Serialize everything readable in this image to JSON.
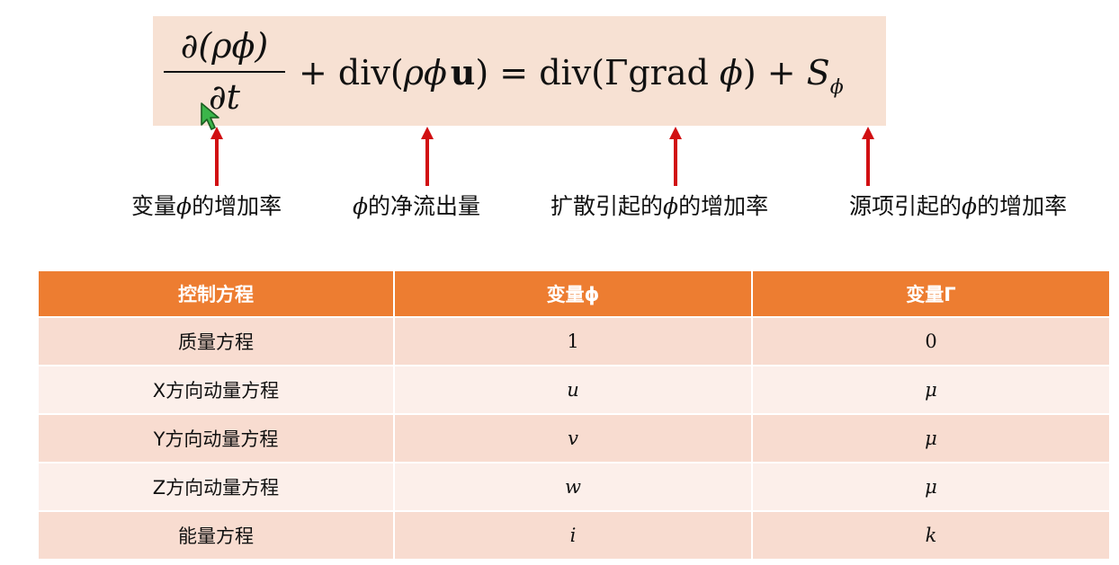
{
  "equation": {
    "numerator": "∂(ρϕ)",
    "denominator": "∂t",
    "plus1": "+ div(",
    "rho_phi": "ρϕ",
    "u": "u",
    "eq_mid": ") = div(Γgrad ",
    "phi2": "ϕ",
    "close_plus": ") + ",
    "S": "S",
    "S_sub": "ϕ"
  },
  "annotations": [
    {
      "pre": "变量",
      "phi": "ϕ",
      "post": "的增加率"
    },
    {
      "pre": "",
      "phi": "ϕ",
      "post": "的净流出量"
    },
    {
      "pre": "扩散引起的",
      "phi": "ϕ",
      "post": "的增加率"
    },
    {
      "pre": "源项引起的",
      "phi": "ϕ",
      "post": "的增加率"
    }
  ],
  "table": {
    "headers": [
      "控制方程",
      "变量ϕ",
      "变量Γ"
    ],
    "rows": [
      [
        "质量方程",
        "1",
        "0"
      ],
      [
        "X方向动量方程",
        "u",
        "μ"
      ],
      [
        "Y方向动量方程",
        "v",
        "μ"
      ],
      [
        "Z方向动量方程",
        "w",
        "μ"
      ],
      [
        "能量方程",
        "i",
        "k"
      ]
    ]
  },
  "colors": {
    "equation_bg": "#f7e1d3",
    "arrow": "#d10f12",
    "header_bg": "#ed7d31",
    "row_odd": "#f8dcd0",
    "row_even": "#fcefea"
  }
}
